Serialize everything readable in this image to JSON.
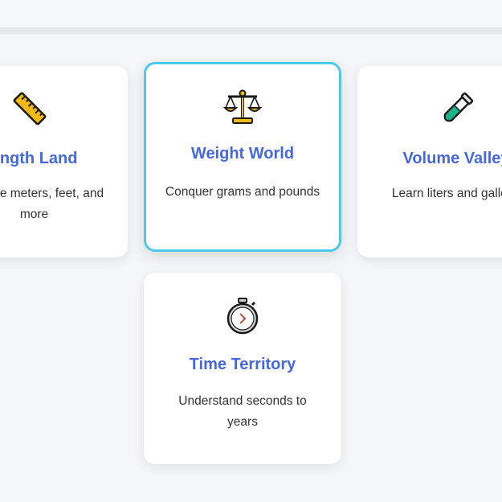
{
  "cards": [
    {
      "id": "length",
      "title": "Length Land",
      "description": "Explore meters, feet, and more",
      "icon": "ruler-icon"
    },
    {
      "id": "weight",
      "title": "Weight World",
      "description": "Conquer grams and pounds",
      "icon": "scales-icon",
      "selected": true
    },
    {
      "id": "volume",
      "title": "Volume Valley",
      "description": "Learn liters and gallons",
      "icon": "test-tube-icon"
    },
    {
      "id": "time",
      "title": "Time Territory",
      "description": "Understand seconds to years",
      "icon": "stopwatch-icon"
    }
  ],
  "colors": {
    "title": "#4567e0",
    "selected_border": "#4fc8ea",
    "background": "#f5f6f8"
  }
}
